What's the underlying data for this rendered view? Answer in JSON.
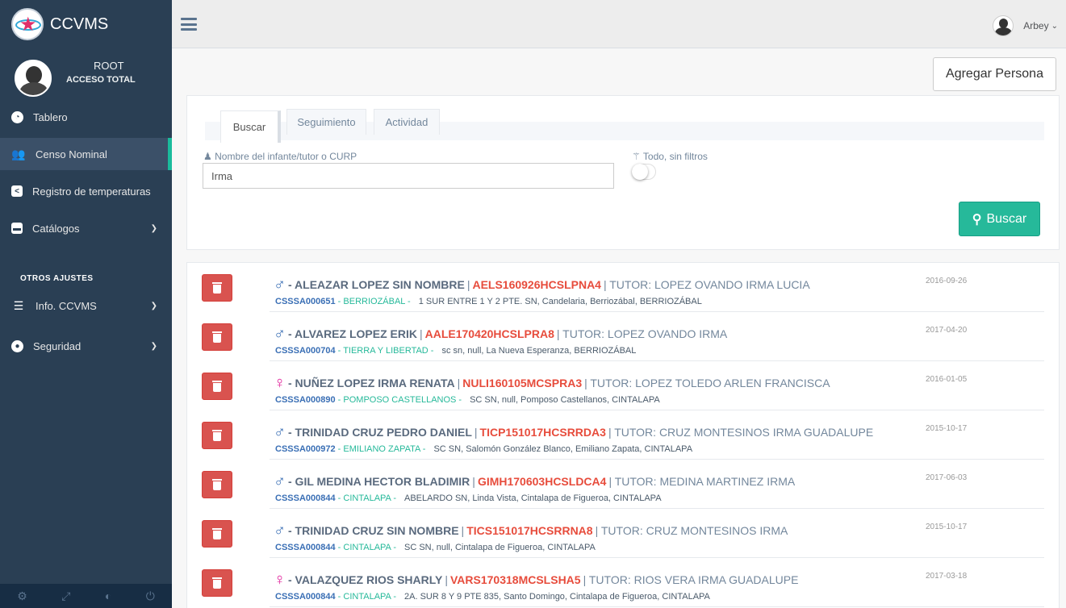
{
  "app": {
    "brand": "CCVMS"
  },
  "profile": {
    "name": "ROOT",
    "role": "ACCESO TOTAL"
  },
  "topnav": {
    "user": "Arbey"
  },
  "sidebar": {
    "items": [
      {
        "label": "Tablero",
        "icon": "dashboard-icon"
      },
      {
        "label": "Censo Nominal",
        "icon": "users-icon"
      },
      {
        "label": "Registro de temperaturas",
        "icon": "share-icon"
      },
      {
        "label": "Catálogos",
        "icon": "archive-icon"
      }
    ],
    "section": "OTROS AJUSTES",
    "extra": [
      {
        "label": "Info. CCVMS",
        "icon": "server-icon"
      },
      {
        "label": "Seguridad",
        "icon": "shield-icon"
      }
    ]
  },
  "actions": {
    "add_person": "Agregar Persona",
    "search": "Buscar"
  },
  "tabs": [
    "Buscar",
    "Seguimiento",
    "Actividad"
  ],
  "search": {
    "label": "Nombre del infante/tutor o CURP",
    "value": "Irma",
    "nofilter_label": "Todo, sin filtros"
  },
  "results": [
    {
      "sex": "male",
      "name": "- ALEAZAR LOPEZ SIN NOMBRE",
      "curp": "AELS160926HCSLPNA4",
      "tutor": "| TUTOR: LOPEZ OVANDO IRMA LUCIA",
      "clues": "CSSSA000651",
      "loc": "- BERRIOZÁBAL -",
      "addr": "1 SUR ENTRE 1 Y 2 PTE. SN, Candelaria, Berriozábal, BERRIOZÁBAL",
      "date": "2016-09-26"
    },
    {
      "sex": "male",
      "name": "- ALVAREZ LOPEZ ERIK",
      "curp": "AALE170420HCSLPRA8",
      "tutor": "| TUTOR: LOPEZ OVANDO IRMA",
      "clues": "CSSSA000704",
      "loc": "- TIERRA Y LIBERTAD -",
      "addr": "sc sn, null, La Nueva Esperanza, BERRIOZÁBAL",
      "date": "2017-04-20"
    },
    {
      "sex": "female",
      "name": "- NUÑEZ LOPEZ IRMA RENATA",
      "curp": "NULI160105MCSPRA3",
      "tutor": "| TUTOR: LOPEZ TOLEDO ARLEN FRANCISCA",
      "clues": "CSSSA000890",
      "loc": "- POMPOSO CASTELLANOS -",
      "addr": "SC SN, null, Pomposo Castellanos, CINTALAPA",
      "date": "2016-01-05"
    },
    {
      "sex": "male",
      "name": "- TRINIDAD CRUZ PEDRO DANIEL",
      "curp": "TICP151017HCSRRDA3",
      "tutor": "| TUTOR: CRUZ MONTESINOS IRMA GUADALUPE",
      "clues": "CSSSA000972",
      "loc": "- EMILIANO ZAPATA -",
      "addr": "SC SN, Salomón González Blanco, Emiliano Zapata, CINTALAPA",
      "date": "2015-10-17"
    },
    {
      "sex": "male",
      "name": "- GIL MEDINA HECTOR BLADIMIR",
      "curp": "GIMH170603HCSLDCA4",
      "tutor": "| TUTOR: MEDINA MARTINEZ IRMA",
      "clues": "CSSSA000844",
      "loc": "- CINTALAPA -",
      "addr": "ABELARDO SN, Linda Vista, Cintalapa de Figueroa, CINTALAPA",
      "date": "2017-06-03"
    },
    {
      "sex": "male",
      "name": "- TRINIDAD CRUZ SIN NOMBRE",
      "curp": "TICS151017HCSRRNA8",
      "tutor": "| TUTOR: CRUZ MONTESINOS IRMA",
      "clues": "CSSSA000844",
      "loc": "- CINTALAPA -",
      "addr": "SC SN, null, Cintalapa de Figueroa, CINTALAPA",
      "date": "2015-10-17"
    },
    {
      "sex": "female",
      "name": "- VALAZQUEZ RIOS SHARLY",
      "curp": "VARS170318MCSLSHA5",
      "tutor": "| TUTOR: RIOS VERA IRMA GUADALUPE",
      "clues": "CSSSA000844",
      "loc": "- CINTALAPA -",
      "addr": "2A. SUR 8 Y 9 PTE 835, Santo Domingo, Cintalapa de Figueroa, CINTALAPA",
      "date": "2017-03-18"
    }
  ],
  "colors": {
    "sidebar": "#2a3f54",
    "accent": "#1abb9c",
    "search_btn": "#26b99a",
    "delete_btn": "#d9534f",
    "curp": "#e74c3c"
  }
}
